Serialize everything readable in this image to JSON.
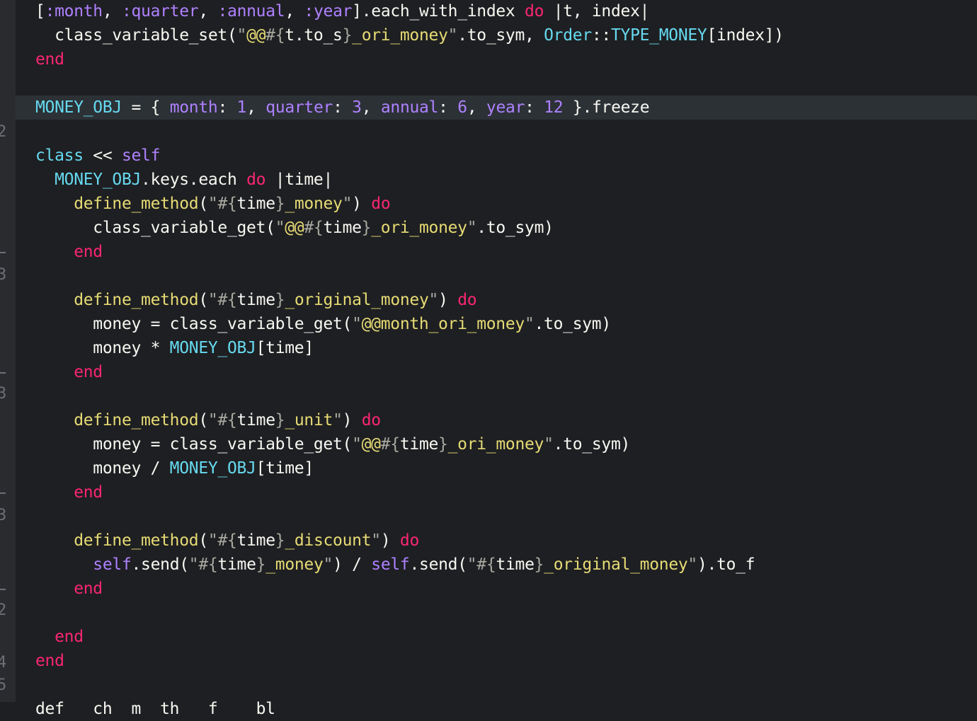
{
  "gutter": {
    "numbers": [
      "2",
      "3",
      "3",
      "3",
      "2",
      "4",
      "5"
    ]
  },
  "code": {
    "lines": [
      [
        [
          "p",
          "["
        ],
        [
          "sym",
          ":month"
        ],
        [
          "p",
          ", "
        ],
        [
          "sym",
          ":quarter"
        ],
        [
          "p",
          ", "
        ],
        [
          "sym",
          ":annual"
        ],
        [
          "p",
          ", "
        ],
        [
          "sym",
          ":year"
        ],
        [
          "p",
          "].each_with_index "
        ],
        [
          "kw",
          "do"
        ],
        [
          "p",
          " |t, index|"
        ]
      ],
      [
        [
          "p",
          "  class_variable_set("
        ],
        [
          "sq",
          "\""
        ],
        [
          "str",
          "@@"
        ],
        [
          "sq",
          "#{"
        ],
        [
          "p",
          "t.to_s"
        ],
        [
          "sq",
          "}"
        ],
        [
          "str",
          "_ori_money"
        ],
        [
          "sq",
          "\""
        ],
        [
          "p",
          ".to_sym, "
        ],
        [
          "cn",
          "Order"
        ],
        [
          "p",
          "::"
        ],
        [
          "cn",
          "TYPE_MONEY"
        ],
        [
          "p",
          "[index])"
        ]
      ],
      [
        [
          "kw",
          "end"
        ]
      ],
      [
        [
          "p",
          ""
        ]
      ],
      [
        [
          "cn",
          "MONEY_OBJ"
        ],
        [
          "p",
          " = { "
        ],
        [
          "sym",
          "month"
        ],
        [
          "p",
          ": "
        ],
        [
          "num",
          "1"
        ],
        [
          "p",
          ", "
        ],
        [
          "sym",
          "quarter"
        ],
        [
          "p",
          ": "
        ],
        [
          "num",
          "3"
        ],
        [
          "p",
          ", "
        ],
        [
          "sym",
          "annual"
        ],
        [
          "p",
          ": "
        ],
        [
          "num",
          "6"
        ],
        [
          "p",
          ", "
        ],
        [
          "sym",
          "year"
        ],
        [
          "p",
          ": "
        ],
        [
          "num",
          "12"
        ],
        [
          "p",
          " }.freeze"
        ]
      ],
      [
        [
          "p",
          ""
        ]
      ],
      [
        [
          "cn",
          "class"
        ],
        [
          "p",
          " << "
        ],
        [
          "self",
          "self"
        ]
      ],
      [
        [
          "p",
          "  "
        ],
        [
          "cn",
          "MONEY_OBJ"
        ],
        [
          "p",
          ".keys.each "
        ],
        [
          "kw",
          "do"
        ],
        [
          "p",
          " |time|"
        ]
      ],
      [
        [
          "p",
          "    "
        ],
        [
          "fn",
          "define_method"
        ],
        [
          "p",
          "("
        ],
        [
          "sq",
          "\"#{"
        ],
        [
          "p",
          "time"
        ],
        [
          "sq",
          "}"
        ],
        [
          "str",
          "_money"
        ],
        [
          "sq",
          "\""
        ],
        [
          "p",
          ") "
        ],
        [
          "kw",
          "do"
        ]
      ],
      [
        [
          "p",
          "      class_variable_get("
        ],
        [
          "sq",
          "\""
        ],
        [
          "str",
          "@@"
        ],
        [
          "sq",
          "#{"
        ],
        [
          "p",
          "time"
        ],
        [
          "sq",
          "}"
        ],
        [
          "str",
          "_ori_money"
        ],
        [
          "sq",
          "\""
        ],
        [
          "p",
          ".to_sym)"
        ]
      ],
      [
        [
          "p",
          "    "
        ],
        [
          "kw",
          "end"
        ]
      ],
      [
        [
          "p",
          ""
        ]
      ],
      [
        [
          "p",
          "    "
        ],
        [
          "fn",
          "define_method"
        ],
        [
          "p",
          "("
        ],
        [
          "sq",
          "\"#{"
        ],
        [
          "p",
          "time"
        ],
        [
          "sq",
          "}"
        ],
        [
          "str",
          "_original_money"
        ],
        [
          "sq",
          "\""
        ],
        [
          "p",
          ") "
        ],
        [
          "kw",
          "do"
        ]
      ],
      [
        [
          "p",
          "      money = class_variable_get("
        ],
        [
          "sq",
          "\""
        ],
        [
          "str",
          "@@month_ori_money"
        ],
        [
          "sq",
          "\""
        ],
        [
          "p",
          ".to_sym)"
        ]
      ],
      [
        [
          "p",
          "      money * "
        ],
        [
          "cn",
          "MONEY_OBJ"
        ],
        [
          "p",
          "[time]"
        ]
      ],
      [
        [
          "p",
          "    "
        ],
        [
          "kw",
          "end"
        ]
      ],
      [
        [
          "p",
          ""
        ]
      ],
      [
        [
          "p",
          "    "
        ],
        [
          "fn",
          "define_method"
        ],
        [
          "p",
          "("
        ],
        [
          "sq",
          "\"#{"
        ],
        [
          "p",
          "time"
        ],
        [
          "sq",
          "}"
        ],
        [
          "str",
          "_unit"
        ],
        [
          "sq",
          "\""
        ],
        [
          "p",
          ") "
        ],
        [
          "kw",
          "do"
        ]
      ],
      [
        [
          "p",
          "      money = class_variable_get("
        ],
        [
          "sq",
          "\""
        ],
        [
          "str",
          "@@"
        ],
        [
          "sq",
          "#{"
        ],
        [
          "p",
          "time"
        ],
        [
          "sq",
          "}"
        ],
        [
          "str",
          "_ori_money"
        ],
        [
          "sq",
          "\""
        ],
        [
          "p",
          ".to_sym)"
        ]
      ],
      [
        [
          "p",
          "      money / "
        ],
        [
          "cn",
          "MONEY_OBJ"
        ],
        [
          "p",
          "[time]"
        ]
      ],
      [
        [
          "p",
          "    "
        ],
        [
          "kw",
          "end"
        ]
      ],
      [
        [
          "p",
          ""
        ]
      ],
      [
        [
          "p",
          "    "
        ],
        [
          "fn",
          "define_method"
        ],
        [
          "p",
          "("
        ],
        [
          "sq",
          "\"#{"
        ],
        [
          "p",
          "time"
        ],
        [
          "sq",
          "}"
        ],
        [
          "str",
          "_discount"
        ],
        [
          "sq",
          "\""
        ],
        [
          "p",
          ") "
        ],
        [
          "kw",
          "do"
        ]
      ],
      [
        [
          "p",
          "      "
        ],
        [
          "self",
          "self"
        ],
        [
          "p",
          ".send("
        ],
        [
          "sq",
          "\"#{"
        ],
        [
          "p",
          "time"
        ],
        [
          "sq",
          "}"
        ],
        [
          "str",
          "_money"
        ],
        [
          "sq",
          "\""
        ],
        [
          "p",
          ") / "
        ],
        [
          "self",
          "self"
        ],
        [
          "p",
          ".send("
        ],
        [
          "sq",
          "\"#{"
        ],
        [
          "p",
          "time"
        ],
        [
          "sq",
          "}"
        ],
        [
          "str",
          "_original_money"
        ],
        [
          "sq",
          "\""
        ],
        [
          "p",
          ").to_f"
        ]
      ],
      [
        [
          "p",
          "    "
        ],
        [
          "kw",
          "end"
        ]
      ],
      [
        [
          "p",
          ""
        ]
      ],
      [
        [
          "p",
          "  "
        ],
        [
          "kw",
          "end"
        ]
      ],
      [
        [
          "kw",
          "end"
        ]
      ],
      [
        [
          "p",
          ""
        ]
      ],
      [
        [
          "p",
          "def   ch  m  th   f    bl   "
        ]
      ]
    ],
    "current_line_index": 4
  }
}
